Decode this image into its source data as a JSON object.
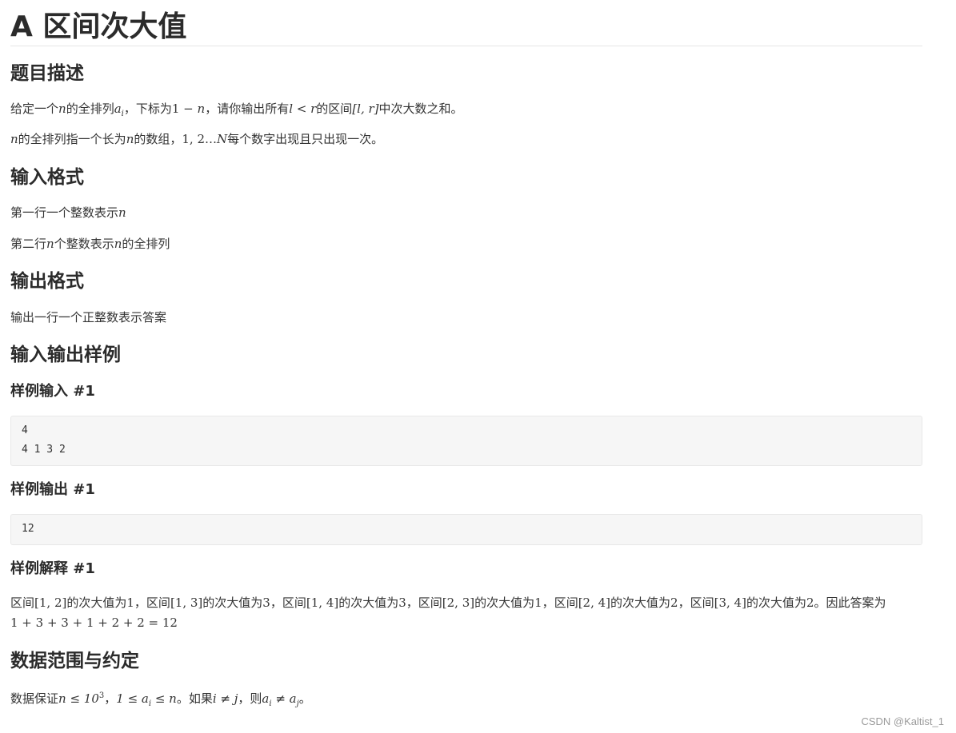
{
  "title": "A 区间次大值",
  "sections": {
    "description": {
      "heading": "题目描述",
      "p1": {
        "t1": "给定一个",
        "n1": "n",
        "t2": "的全排列",
        "a": "a",
        "i": "i",
        "t3": "，下标为",
        "range": "1 − ",
        "n2": "n",
        "t4": "，请你输出所有",
        "cond": "l < r",
        "t5": "的区间",
        "interval": "[l, r]",
        "t6": "中次大数之和。"
      },
      "p2": {
        "n": "n",
        "t1": "的全排列指一个长为",
        "n2": "n",
        "t2": "的数组，",
        "seq": "1, 2…",
        "N": "N",
        "t3": "每个数字出现且只出现一次。"
      }
    },
    "input": {
      "heading": "输入格式",
      "line1": {
        "t1": "第一行一个整数表示",
        "n": "n"
      },
      "line2": {
        "t1": "第二行",
        "n1": "n",
        "t2": "个整数表示",
        "n2": "n",
        "t3": "的全排列"
      }
    },
    "output": {
      "heading": "输出格式",
      "line1": "输出一行一个正整数表示答案"
    },
    "samples": {
      "heading": "输入输出样例",
      "input_heading": "样例输入 #1",
      "input_lines": [
        "4",
        "4 1 3 2"
      ],
      "output_heading": "样例输出 #1",
      "output_lines": [
        "12"
      ],
      "explain_heading": "样例解释 #1",
      "explain": {
        "q": "区间",
        "i1": "[1, 2]",
        "v1": "1",
        "i2": "[1, 3]",
        "v2": "3",
        "i3": "[1, 4]",
        "v3": "3",
        "i4": "[2, 3]",
        "v4": "1",
        "i5": "[2, 4]",
        "v5": "2",
        "i6": "[3, 4]",
        "v6": "2",
        "mid": "的次大值为",
        "sep": "，",
        "end": "。因此答案为",
        "sum": "1 + 3 + 3 + 1 + 2 + 2 = 12"
      }
    },
    "range": {
      "heading": "数据范围与约定",
      "t1": "数据保证",
      "c1": "n ≤ 10",
      "exp": "3",
      "t2": "，",
      "c2a": "1 ≤ a",
      "c2sub": "i",
      "c2b": " ≤ n",
      "t3": "。如果",
      "c3": "i ≠ j",
      "t4": "，则",
      "c4a": "a",
      "c4sub1": "i",
      "c4b": " ≠ a",
      "c4sub2": "j",
      "t5": "。"
    }
  },
  "watermark": "CSDN @Kaltist_1"
}
